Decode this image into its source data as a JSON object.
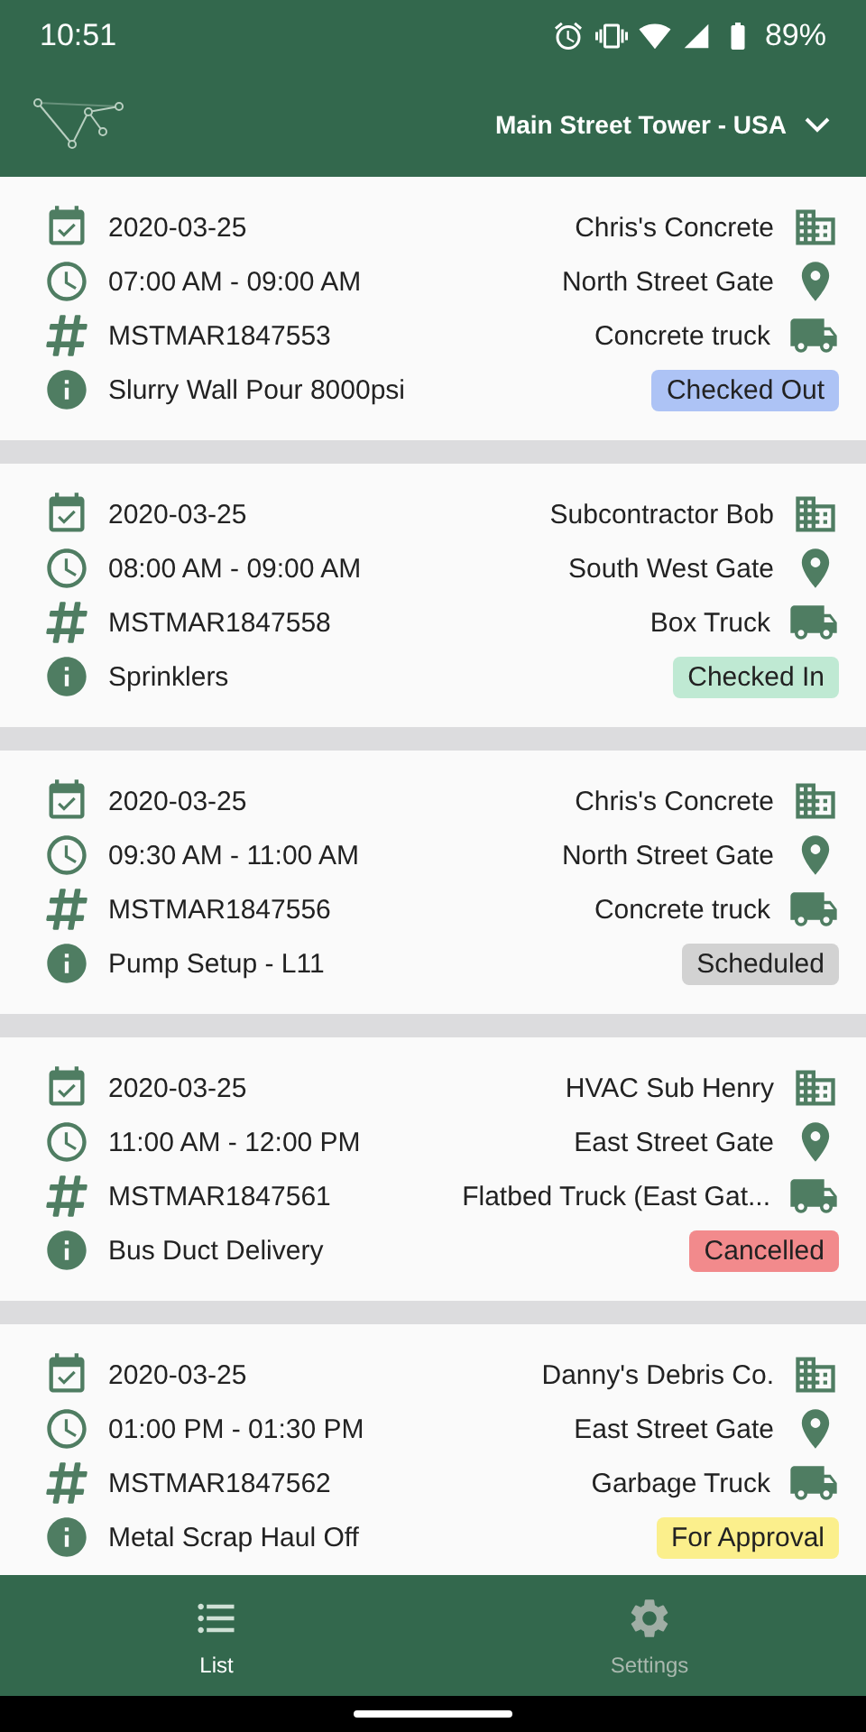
{
  "status_bar": {
    "time": "10:51",
    "battery": "89%"
  },
  "header": {
    "site": "Main Street Tower - USA"
  },
  "deliveries": [
    {
      "date": "2020-03-25",
      "time": "07:00 AM - 09:00 AM",
      "number": "MSTMAR1847553",
      "description": "Slurry Wall Pour 8000psi",
      "company": "Chris's Concrete",
      "gate": "North Street Gate",
      "vehicle": "Concrete truck",
      "status": {
        "label": "Checked Out",
        "color": "#adc3f5"
      }
    },
    {
      "date": "2020-03-25",
      "time": "08:00 AM - 09:00 AM",
      "number": "MSTMAR1847558",
      "description": "Sprinklers",
      "company": "Subcontractor Bob",
      "gate": "South West Gate",
      "vehicle": "Box Truck",
      "status": {
        "label": "Checked In",
        "color": "#bfe9d3"
      }
    },
    {
      "date": "2020-03-25",
      "time": "09:30 AM - 11:00 AM",
      "number": "MSTMAR1847556",
      "description": "Pump Setup - L11",
      "company": "Chris's Concrete",
      "gate": "North Street Gate",
      "vehicle": "Concrete truck",
      "status": {
        "label": "Scheduled",
        "color": "#d2d2d2"
      }
    },
    {
      "date": "2020-03-25",
      "time": "11:00 AM - 12:00 PM",
      "number": "MSTMAR1847561",
      "description": "Bus Duct Delivery",
      "company": "HVAC Sub Henry",
      "gate": "East Street Gate",
      "vehicle": "Flatbed Truck (East Gat...",
      "status": {
        "label": "Cancelled",
        "color": "#f28a8c"
      }
    },
    {
      "date": "2020-03-25",
      "time": "01:00 PM - 01:30 PM",
      "number": "MSTMAR1847562",
      "description": "Metal Scrap Haul Off",
      "company": "Danny's Debris Co.",
      "gate": "East Street Gate",
      "vehicle": "Garbage Truck",
      "status": {
        "label": "For Approval",
        "color": "#fbef8c"
      }
    }
  ],
  "nav": [
    {
      "label": "List",
      "kind": "list",
      "selected": true
    },
    {
      "label": "Settings",
      "kind": "settings",
      "selected": false
    }
  ]
}
